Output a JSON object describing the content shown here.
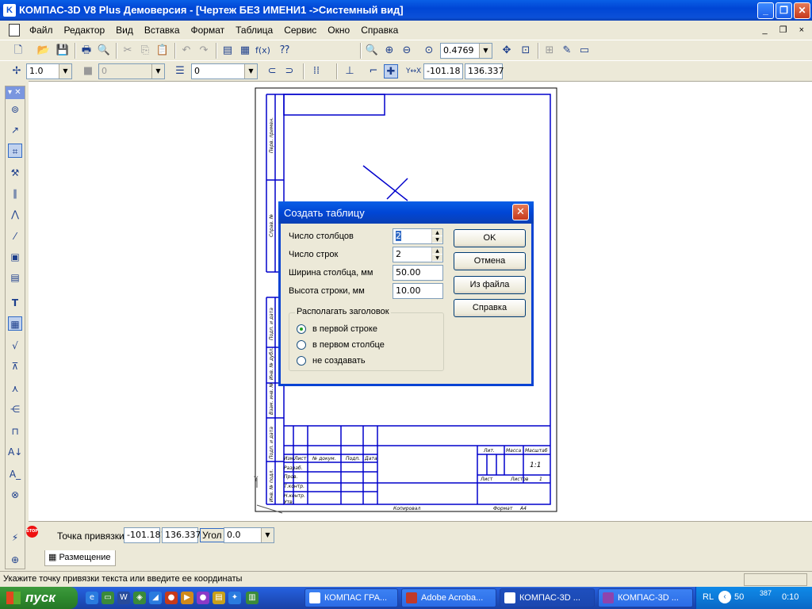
{
  "window": {
    "title": "КОМПАС-3D V8 Plus Демоверсия - [Чертеж БЕЗ ИМЕНИ1 ->Системный вид]",
    "app_icon": "kompas-icon",
    "minimize": "_",
    "maximize": "❐",
    "close": "✕"
  },
  "menu": {
    "items": [
      "Файл",
      "Редактор",
      "Вид",
      "Вставка",
      "Формат",
      "Таблица",
      "Сервис",
      "Окно",
      "Справка"
    ],
    "mdi_buttons": "_ ❐ ×"
  },
  "toolbar1": {
    "zoom_value": "0.4769"
  },
  "toolbar2": {
    "step_value": "1.0",
    "style_value": "0",
    "layer_value": "0",
    "coord_x": "-101.18",
    "coord_y": "136.337",
    "coord_label": "Y↔X"
  },
  "left_panel": {
    "header": "▾ ✕"
  },
  "dialog": {
    "title": "Создать таблицу",
    "columns_label": "Число столбцов",
    "columns_value": "2",
    "rows_label": "Число строк",
    "rows_value": "2",
    "col_width_label": "Ширина столбца, мм",
    "col_width_value": "50.00",
    "row_height_label": "Высота строки, мм",
    "row_height_value": "10.00",
    "header_group": "Располагать заголовок",
    "radio_first_row": "в первой строке",
    "radio_first_col": "в первом столбце",
    "radio_none": "не создавать",
    "selected_radio": "first_row",
    "ok": "OK",
    "cancel": "Отмена",
    "from_file": "Из файла",
    "help": "Справка"
  },
  "drawing_labels": {
    "perv_primen": "Перв. примен.",
    "sprav_no": "Справ. №",
    "podp_data1": "Подп. и дата",
    "inv_dubl": "Инв. № дубл.",
    "vzam_inv": "Взам. инв. №",
    "podp_data2": "Подп. и дата",
    "inv_podl": "Инв. № подл.",
    "izm": "Изм.",
    "list_col": "Лист",
    "doc_no": "№ докум.",
    "podp": "Подп.",
    "data": "Дата",
    "razrab": "Разраб.",
    "prov": "Пров.",
    "t_kontr": "Т.контр.",
    "n_kontr": "Н.контр.",
    "utv": "Утв.",
    "lit": "Лит.",
    "massa": "Масса",
    "masshtab": "Масштаб",
    "scale_value": "1:1",
    "list_label": "Лист",
    "listov_label": "Листов",
    "listov_value": "1",
    "kopiroval": "Копировал",
    "format": "Формат",
    "format_value": "A4",
    "axis_y": "Y"
  },
  "propbar": {
    "snap_label": "Точка привязки",
    "snap_x": "-101.181",
    "snap_y": "136.337",
    "angle_label": "Угол",
    "angle_value": "0.0",
    "tab_label": "Размещение",
    "stop_label": "STOP"
  },
  "status": {
    "text": "Укажите точку привязки текста или введите ее координаты"
  },
  "taskbar": {
    "start": "пуск",
    "tasks": [
      "КОМПАС ГРА...",
      "Adobe Acroba...",
      "КОМПАС-3D ...",
      "КОМПАС-3D ..."
    ],
    "lang": "RL",
    "tray_num1": "50",
    "tray_num2": "387",
    "clock": "0:10"
  }
}
